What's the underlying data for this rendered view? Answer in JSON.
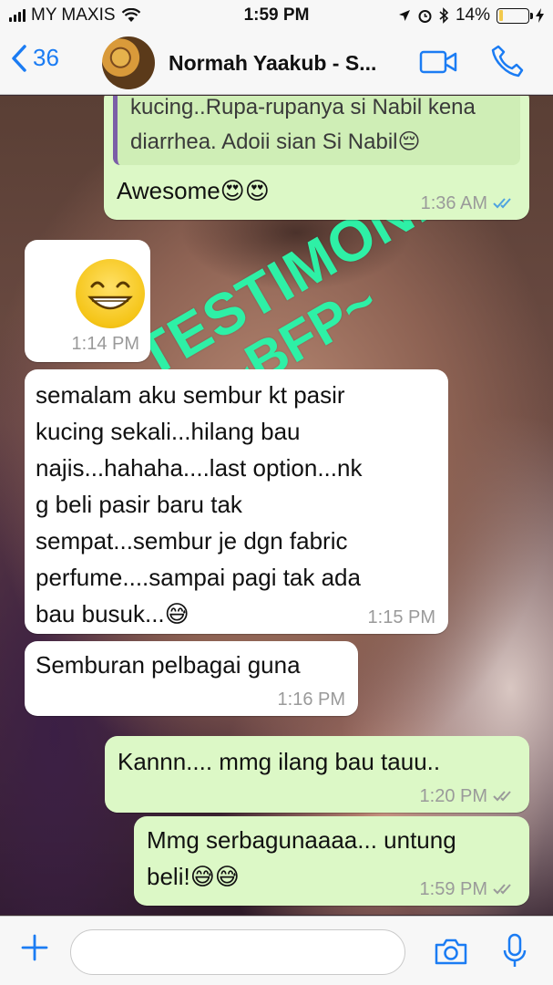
{
  "status_bar": {
    "carrier": "MY MAXIS",
    "time": "1:59 PM",
    "battery": "14%",
    "battery_level": 0.14
  },
  "nav": {
    "back_count": "36",
    "contact_name": "Normah Yaakub - S..."
  },
  "watermark": {
    "line1": "TESTIMONI",
    "line2": "~BFP~"
  },
  "messages": [
    {
      "direction": "out",
      "quoted_text_1": "kucing..Rupa-rupanya si Nabil kena",
      "quoted_text_2": "diarrhea. Adoii sian Si Nabil😔",
      "text": "Awesome😍😍",
      "time": "1:36 AM",
      "status": "read"
    },
    {
      "direction": "in",
      "emoji": "grinning-face",
      "time": "1:14 PM"
    },
    {
      "direction": "in",
      "line1": "semalam aku sembur kt pasir",
      "line2": "kucing sekali...hilang bau",
      "line3": "najis...hahaha....last option...nk",
      "line4": "g beli pasir baru tak",
      "line5": "sempat...sembur je dgn fabric",
      "line6": "perfume....sampai pagi tak ada",
      "line7": "bau busuk...😅",
      "time": "1:15 PM"
    },
    {
      "direction": "in",
      "text": "Semburan pelbagai guna",
      "time": "1:16 PM"
    },
    {
      "direction": "out",
      "text": "Kannn.... mmg ilang bau tauu..",
      "time": "1:20 PM",
      "status": "delivered"
    },
    {
      "direction": "out",
      "line1": "Mmg serbagunaaaa... untung",
      "line2": "beli!😅😅",
      "time": "1:59 PM",
      "status": "delivered"
    }
  ],
  "input": {
    "placeholder": ""
  },
  "colors": {
    "accent": "#1b7cf3",
    "outgoing_bubble": "#dcf8c6",
    "incoming_bubble": "#ffffff",
    "watermark": "#2ef0a6",
    "read_tick": "#4fa3e0",
    "delivered_tick": "#9a9a9a"
  }
}
